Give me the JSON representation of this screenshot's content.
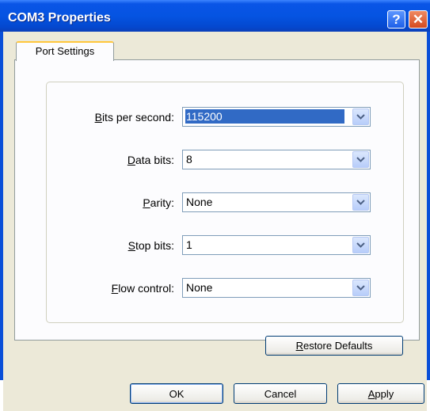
{
  "window": {
    "title": "COM3 Properties",
    "help_symbol": "?",
    "close_symbol": "✕"
  },
  "tabs": [
    {
      "label": "Port Settings",
      "active": true
    }
  ],
  "fields": {
    "bits_per_second": {
      "label_key": "B",
      "label_rest": "its per second:",
      "value": "115200"
    },
    "data_bits": {
      "label_key": "D",
      "label_rest": "ata bits:",
      "value": "8"
    },
    "parity": {
      "label_pre": "",
      "label_key": "P",
      "label_rest": "arity:",
      "value": "None"
    },
    "stop_bits": {
      "label_key": "S",
      "label_rest": "top bits:",
      "value": "1"
    },
    "flow_control": {
      "label_key": "F",
      "label_rest": "low control:",
      "value": "None"
    }
  },
  "buttons": {
    "restore_key": "R",
    "restore_rest": "estore Defaults",
    "ok": "OK",
    "cancel": "Cancel",
    "apply_key": "A",
    "apply_rest": "pply"
  },
  "colors": {
    "titlebar": "#0554e2",
    "dialog_bg": "#ece9d8",
    "selection": "#316ac5",
    "tab_highlight": "#ffc73c"
  },
  "icons": {
    "dropdown": "chevron-down-icon",
    "help": "help-icon",
    "close": "close-icon"
  }
}
